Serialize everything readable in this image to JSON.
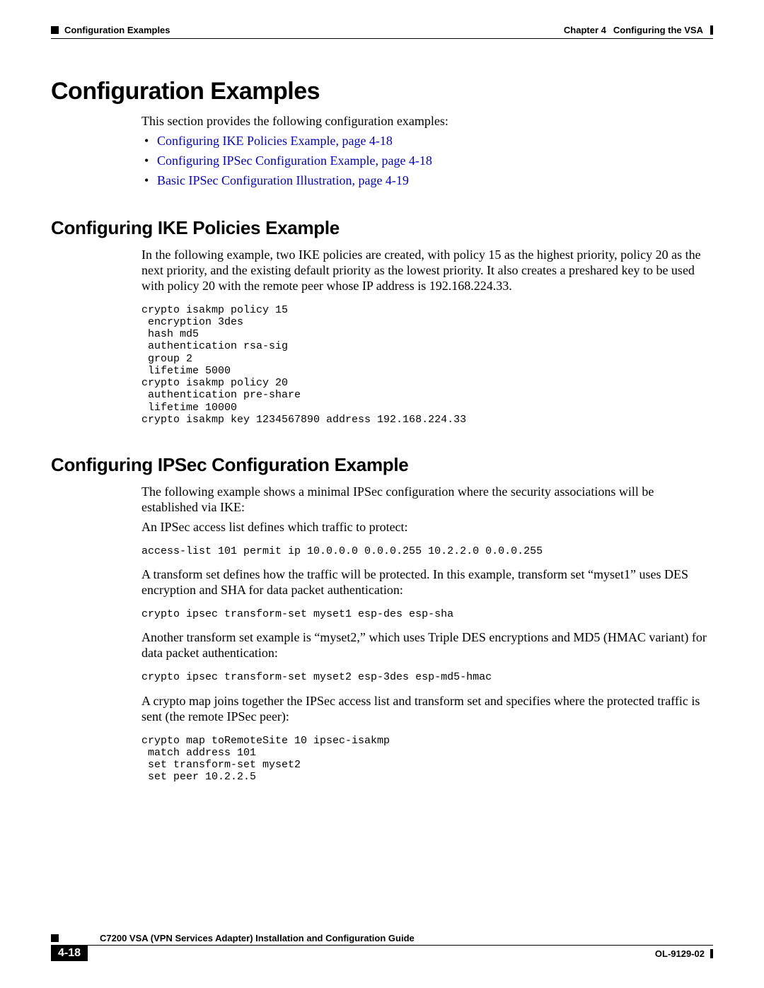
{
  "header": {
    "left_section": "Configuration Examples",
    "chapter_label": "Chapter 4",
    "chapter_title": "Configuring the VSA"
  },
  "h1": "Configuration Examples",
  "intro": "This section provides the following configuration examples:",
  "links": [
    "Configuring IKE Policies Example, page 4-18",
    "Configuring IPSec Configuration Example, page 4-18",
    "Basic IPSec Configuration Illustration, page 4-19"
  ],
  "sec1": {
    "title": "Configuring IKE Policies Example",
    "para": "In the following example, two IKE policies are created, with policy 15 as the highest priority, policy 20 as the next priority, and the existing default priority as the lowest priority. It also creates a preshared key to be used with policy 20 with the remote peer whose IP address is 192.168.224.33.",
    "code": "crypto isakmp policy 15\n encryption 3des\n hash md5\n authentication rsa-sig\n group 2\n lifetime 5000\ncrypto isakmp policy 20\n authentication pre-share\n lifetime 10000\ncrypto isakmp key 1234567890 address 192.168.224.33"
  },
  "sec2": {
    "title": "Configuring IPSec Configuration Example",
    "p1": "The following example shows a minimal IPSec configuration where the security associations will be established via IKE:",
    "p2": "An IPSec access list defines which traffic to protect:",
    "code1": "access-list 101 permit ip 10.0.0.0 0.0.0.255 10.2.2.0 0.0.0.255",
    "p3": "A transform set defines how the traffic will be protected. In this example, transform set “myset1” uses DES encryption and SHA for data packet authentication:",
    "code2": "crypto ipsec transform-set myset1 esp-des esp-sha",
    "p4": "Another transform set example is “myset2,” which uses Triple DES encryptions and MD5 (HMAC variant) for data packet authentication:",
    "code3": "crypto ipsec transform-set myset2 esp-3des esp-md5-hmac",
    "p5": "A crypto map joins together the IPSec access list and transform set and specifies where the protected traffic is sent (the remote IPSec peer):",
    "code4": "crypto map toRemoteSite 10 ipsec-isakmp\n match address 101\n set transform-set myset2\n set peer 10.2.2.5"
  },
  "footer": {
    "guide": "C7200 VSA (VPN Services Adapter) Installation and Configuration Guide",
    "page": "4-18",
    "docid": "OL-9129-02"
  }
}
